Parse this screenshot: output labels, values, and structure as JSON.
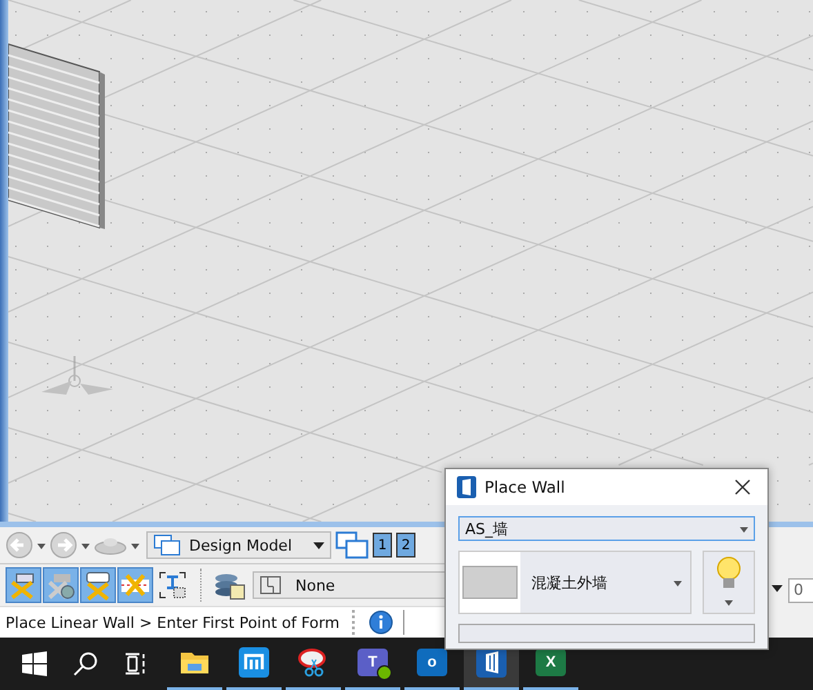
{
  "view_toolbar": {
    "model_dropdown": "Design Model",
    "view_buttons": [
      "1",
      "2"
    ]
  },
  "task_toolbar": {
    "tools": [
      {
        "kind": "beam",
        "on": true
      },
      {
        "kind": "history",
        "on": true
      },
      {
        "kind": "comment",
        "on": true
      },
      {
        "kind": "cut",
        "on": true
      },
      {
        "kind": "select",
        "on": false
      }
    ],
    "level_dropdown": "None"
  },
  "status_bar": {
    "prompt": "Place Linear Wall > Enter First Point of Form"
  },
  "right_strip": {
    "field": "0"
  },
  "dialog": {
    "title": "Place Wall",
    "family_dropdown": "AS_墙",
    "part_name": "混凝土外墙"
  },
  "taskbar": {
    "apps": [
      {
        "kind": "folder",
        "selected": false
      },
      {
        "kind": "browser",
        "selected": false
      },
      {
        "kind": "snip",
        "selected": false
      },
      {
        "kind": "teams",
        "label": "T",
        "selected": false
      },
      {
        "kind": "outlook",
        "label": "o",
        "selected": false
      },
      {
        "kind": "building",
        "selected": true
      },
      {
        "kind": "excel",
        "label": "X",
        "selected": false
      }
    ]
  }
}
